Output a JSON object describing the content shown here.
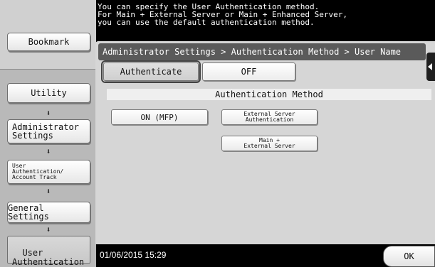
{
  "header": {
    "message": "You can specify the User Authentication method.\nFor Main + External Server or Main + Enhanced Server,\nyou can use the default authentication method."
  },
  "sidebar": {
    "bookmark_label": "Bookmark",
    "items": [
      {
        "label": "Utility"
      },
      {
        "label": "Administrator\nSettings"
      },
      {
        "label": "User\nAuthentication/\nAccount Track"
      },
      {
        "label": "General Settings"
      },
      {
        "label": "User\nAuthentication"
      }
    ],
    "arrow_glyph": "⬇"
  },
  "breadcrumb": "Administrator Settings > Authentication Method > User Name",
  "tabs": [
    {
      "label": "Authenticate",
      "selected": true
    },
    {
      "label": "OFF",
      "selected": false
    }
  ],
  "auth_method": {
    "title": "Authentication Method",
    "options": [
      {
        "label": "ON (MFP)"
      },
      {
        "label": "External Server\nAuthentication"
      },
      {
        "label": "Main +\nExternal Server"
      }
    ]
  },
  "footer": {
    "datetime": "01/06/2015  15:29",
    "ok_label": "OK"
  }
}
